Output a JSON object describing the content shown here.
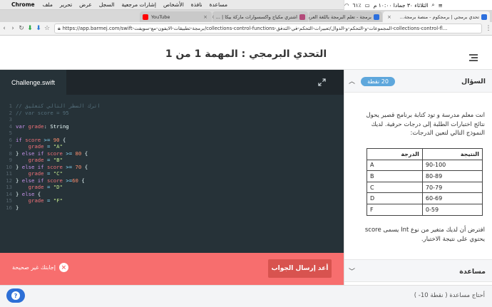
{
  "menubar": {
    "app": "Chrome",
    "menus": [
      "ملف",
      "تحرير",
      "عرض",
      "السجل",
      "إشارات مرجعية",
      "الأشخاص",
      "نافذة",
      "مساعدة"
    ],
    "clock": "الثلاثاء ٣٠ جمادا ١٠:٠٠ م",
    "battery": "٦١٪"
  },
  "tabs": [
    {
      "title": "تحدي برمجي | برمجكوم - منصة برمجة...",
      "active": true
    },
    {
      "title": "برمجة - تعلم البرمجة باللغة العربية للمبتد...",
      "active": false
    },
    {
      "title": "اشتري مكياج واكسسوارات ماركة بيكا | ...",
      "active": false
    },
    {
      "title": "YouTube",
      "active": false
    }
  ],
  "address": {
    "url": "https://app.barmej.com/swift-برمجة-تطبيقات-الايفون-مع-سويفت/collections-control-functions-المجموعات-و-التحكم-و-الدوال/تعبيرات-التحكم-في-التدفق-collections-control-fl..."
  },
  "header": {
    "title": "التحدي البرمجي : المهمة 1 من 1"
  },
  "editor": {
    "filename": "Challenge.swift",
    "lines": [
      [
        {
          "t": "// اترك السطر التالي كتعليق",
          "c": "comment"
        }
      ],
      [
        {
          "t": "// var score = 95",
          "c": "comment"
        }
      ],
      [],
      [
        {
          "t": "var ",
          "c": "key"
        },
        {
          "t": "grade",
          "c": "id"
        },
        {
          "t": ": String",
          "c": "plain"
        }
      ],
      [],
      [
        {
          "t": "if ",
          "c": "key"
        },
        {
          "t": "score",
          "c": "id"
        },
        {
          "t": " >= ",
          "c": "op"
        },
        {
          "t": "90",
          "c": "num"
        },
        {
          "t": " {",
          "c": "plain"
        }
      ],
      [
        {
          "t": "    grade",
          "c": "id"
        },
        {
          "t": " = ",
          "c": "op"
        },
        {
          "t": "\"A\"",
          "c": "str"
        }
      ],
      [
        {
          "t": "} ",
          "c": "plain"
        },
        {
          "t": "else if ",
          "c": "key"
        },
        {
          "t": "score",
          "c": "id"
        },
        {
          "t": " >= ",
          "c": "op"
        },
        {
          "t": "80",
          "c": "num"
        },
        {
          "t": " {",
          "c": "plain"
        }
      ],
      [
        {
          "t": "    grade",
          "c": "id"
        },
        {
          "t": " = ",
          "c": "op"
        },
        {
          "t": "\"B\"",
          "c": "str"
        }
      ],
      [
        {
          "t": "} ",
          "c": "plain"
        },
        {
          "t": "else if ",
          "c": "key"
        },
        {
          "t": "score",
          "c": "id"
        },
        {
          "t": " >= ",
          "c": "op"
        },
        {
          "t": "70",
          "c": "num"
        },
        {
          "t": " {",
          "c": "plain"
        }
      ],
      [
        {
          "t": "    grade",
          "c": "id"
        },
        {
          "t": " = ",
          "c": "op"
        },
        {
          "t": "\"C\"",
          "c": "str"
        }
      ],
      [
        {
          "t": "} ",
          "c": "plain"
        },
        {
          "t": "else if ",
          "c": "key"
        },
        {
          "t": "score",
          "c": "id"
        },
        {
          "t": " >=",
          "c": "op"
        },
        {
          "t": "60",
          "c": "num"
        },
        {
          "t": " {",
          "c": "plain"
        }
      ],
      [
        {
          "t": "    grade",
          "c": "id"
        },
        {
          "t": " = ",
          "c": "op"
        },
        {
          "t": "\"D\"",
          "c": "str"
        }
      ],
      [
        {
          "t": "} ",
          "c": "plain"
        },
        {
          "t": "else",
          "c": "key"
        },
        {
          "t": " {",
          "c": "plain"
        }
      ],
      [
        {
          "t": "    grade",
          "c": "id"
        },
        {
          "t": " = ",
          "c": "op"
        },
        {
          "t": "\"F\"",
          "c": "str"
        }
      ],
      [
        {
          "t": "}",
          "c": "plain"
        }
      ]
    ]
  },
  "feedback": {
    "submit_label": "أعد إرسال الجواب",
    "status_text": "إجابتك غير صحيحة",
    "color": "#f76e6e"
  },
  "question": {
    "section_label": "السؤال",
    "points": "20 نقطة",
    "intro": "انت معلم مدرسة و تود كتابة برنامج قصير يحول نتائج اختبارات الطلبة إلى درجات حرفية. لديك النموذج التالي لتعين الدرجات:",
    "table_headers": [
      "النتيجة",
      "الدرجة"
    ],
    "table_rows": [
      [
        "90-100",
        "A"
      ],
      [
        "80-89",
        "B"
      ],
      [
        "70-79",
        "C"
      ],
      [
        "60-69",
        "D"
      ],
      [
        "0-59",
        "F"
      ]
    ],
    "outro": "افترض أن لديك متغير من نوع Int يسمى score يحتوي على نتيجة الاختبار."
  },
  "help": {
    "section_label": "مساعدة",
    "hint_text": "أحتاج مساعدة ( نقطة 10- )"
  }
}
